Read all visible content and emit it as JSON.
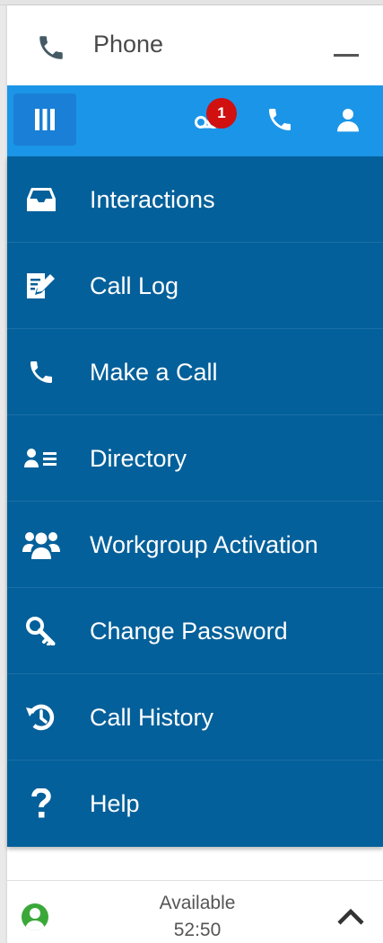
{
  "header": {
    "title": "Phone",
    "icons": {
      "phone": "phone-icon",
      "minimize": "minimize-icon"
    }
  },
  "toolbar": {
    "menu_icon": "menu-bars-icon",
    "notification_count": "1",
    "icons": [
      "voicemail-icon",
      "phone-icon",
      "user-icon"
    ]
  },
  "menu": {
    "items": [
      {
        "label": "Interactions",
        "icon": "inbox-icon"
      },
      {
        "label": "Call Log",
        "icon": "edit-document-icon"
      },
      {
        "label": "Make a Call",
        "icon": "phone-icon"
      },
      {
        "label": "Directory",
        "icon": "contact-list-icon"
      },
      {
        "label": "Workgroup Activation",
        "icon": "users-group-icon"
      },
      {
        "label": "Change Password",
        "icon": "key-icon"
      },
      {
        "label": "Call History",
        "icon": "history-icon"
      },
      {
        "label": "Help",
        "icon": "question-icon"
      }
    ]
  },
  "footer": {
    "status": "Available",
    "timer": "52:50",
    "status_icon": "available-status-icon",
    "expand_icon": "chevron-up-icon"
  },
  "colors": {
    "toolbar": "#1b95e8",
    "menu_button": "#1a7fd6",
    "menu_background": "#04609a",
    "badge": "#d11010",
    "status_available": "#3aa839"
  }
}
